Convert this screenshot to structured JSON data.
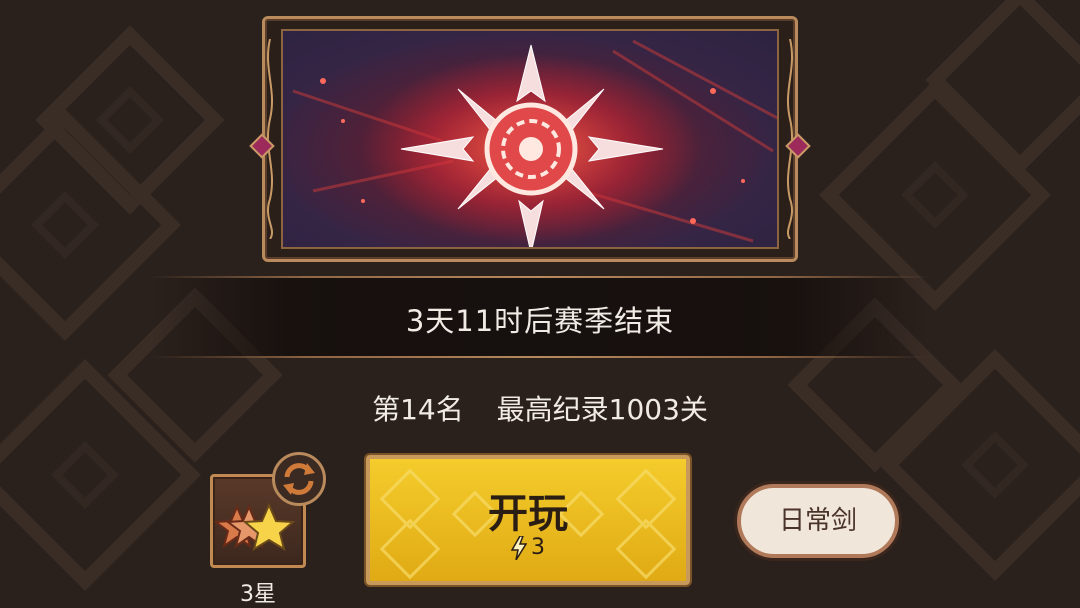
{
  "season": {
    "countdown_text": "3天11时后赛季结束"
  },
  "ranking": {
    "rank_text": "第14名",
    "record_text": "最高纪录1003关"
  },
  "mode": {
    "stars_label": "3星"
  },
  "play": {
    "label": "开玩",
    "energy_cost": "3"
  },
  "daily": {
    "label": "日常剑"
  },
  "colors": {
    "background": "#2b211c",
    "frame_gold": "#b98a5c",
    "play_yellow": "#f0c020",
    "text_light": "#f1ebe5"
  },
  "icons": [
    "season-emblem-icon",
    "refresh-icon",
    "stars-icon",
    "lightning-icon",
    "gem-icon"
  ]
}
